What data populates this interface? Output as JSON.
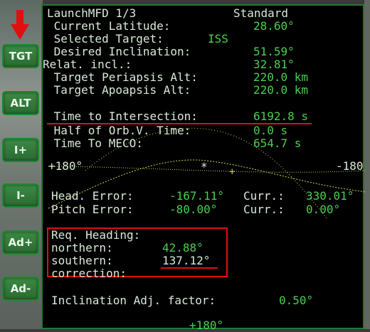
{
  "colors": {
    "label": "#d8ead8",
    "value": "#49d04f",
    "highlight": "#e01010",
    "button": "#2f7a39"
  },
  "side_buttons": [
    "TGT",
    "ALT",
    "I+",
    "I-",
    "Ad+",
    "Ad-"
  ],
  "header": {
    "title": "LaunchMFD 1/3",
    "mode": "Standard"
  },
  "rows": [
    {
      "label": " Current Latitude:",
      "value": "28.60°"
    },
    {
      "label": " Selected Target:",
      "value": "ISS"
    },
    {
      "label": " Desired Inclination:",
      "value": "51.59°"
    },
    {
      "label": "Relat. incl.:",
      "value": "32.81°"
    },
    {
      "label": " Target Periapsis Alt:",
      "value": "220.0 km"
    },
    {
      "label": " Target Apoapsis Alt:",
      "value": "220.0 km"
    },
    {
      "label": " Time to Intersection:",
      "value": "6192.8 s"
    },
    {
      "label": " Half of Orb.V. Time:",
      "value": "0.0 s"
    },
    {
      "label": " Time To MECO:",
      "value": "654.7 s"
    }
  ],
  "plot": {
    "left_label": "+180°",
    "right_label": "-180",
    "bottom_label": "+180°"
  },
  "errors": {
    "head_label": "Head. Error:",
    "head_value": "-167.11°",
    "curr1_label": "Curr.:",
    "curr1_value": "330.01°",
    "pitch_label": "Pitch Error:",
    "pitch_value": "-80.00°",
    "curr2_label": "Curr.:",
    "curr2_value": "0.00°"
  },
  "heading": {
    "title": "Req. Heading:",
    "northern_label": "northern:",
    "northern_value": "42.88°",
    "southern_label": "southern:",
    "southern_value": "137.12°",
    "correction_label": "correction:"
  },
  "inclination_adj": {
    "label": "Inclination Adj. factor:",
    "value": "0.50°"
  }
}
